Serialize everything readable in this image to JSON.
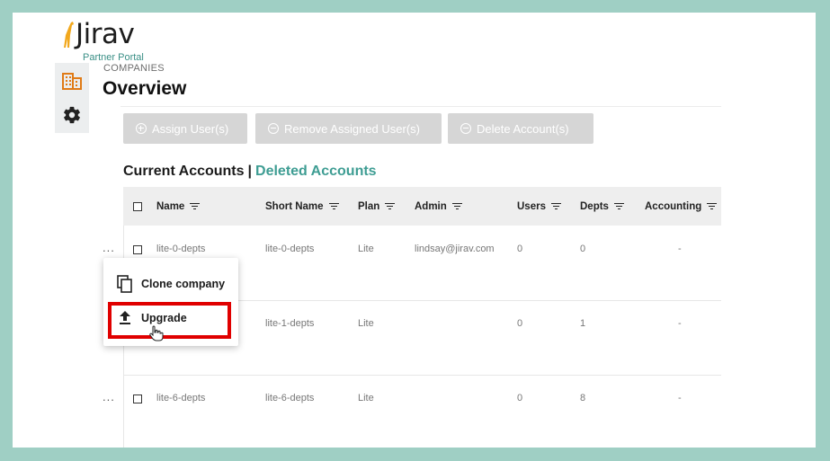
{
  "brand": {
    "name": "Jirav",
    "subtitle": "Partner Portal"
  },
  "rail": {
    "icons": [
      "building-icon",
      "gear-icon"
    ]
  },
  "header": {
    "breadcrumb": "COMPANIES",
    "title": "Overview"
  },
  "actions": {
    "assign": "Assign User(s)",
    "remove": "Remove Assigned User(s)",
    "delete": "Delete Account(s)"
  },
  "accounts_tabs": {
    "current": "Current Accounts",
    "separator": "|",
    "deleted": "Deleted Accounts"
  },
  "table": {
    "headers": [
      "Name",
      "Short Name",
      "Plan",
      "Admin",
      "Users",
      "Depts",
      "Accounting"
    ],
    "rows": [
      {
        "name": "lite-0-depts",
        "short": "lite-0-depts",
        "plan": "Lite",
        "admin": "lindsay@jirav.com",
        "users": "0",
        "depts": "0",
        "accounting": "-"
      },
      {
        "name": "",
        "short": "lite-1-depts",
        "plan": "Lite",
        "admin": "",
        "users": "0",
        "depts": "1",
        "accounting": "-"
      },
      {
        "name": "lite-6-depts",
        "short": "lite-6-depts",
        "plan": "Lite",
        "admin": "",
        "users": "0",
        "depts": "8",
        "accounting": "-"
      }
    ],
    "row_menu": "..."
  },
  "context_menu": {
    "clone": "Clone company",
    "upgrade": "Upgrade"
  },
  "colors": {
    "accent": "#3e9d93",
    "frame": "#9fcfc4",
    "highlight": "#e00000",
    "logo": "#f2a81d"
  }
}
